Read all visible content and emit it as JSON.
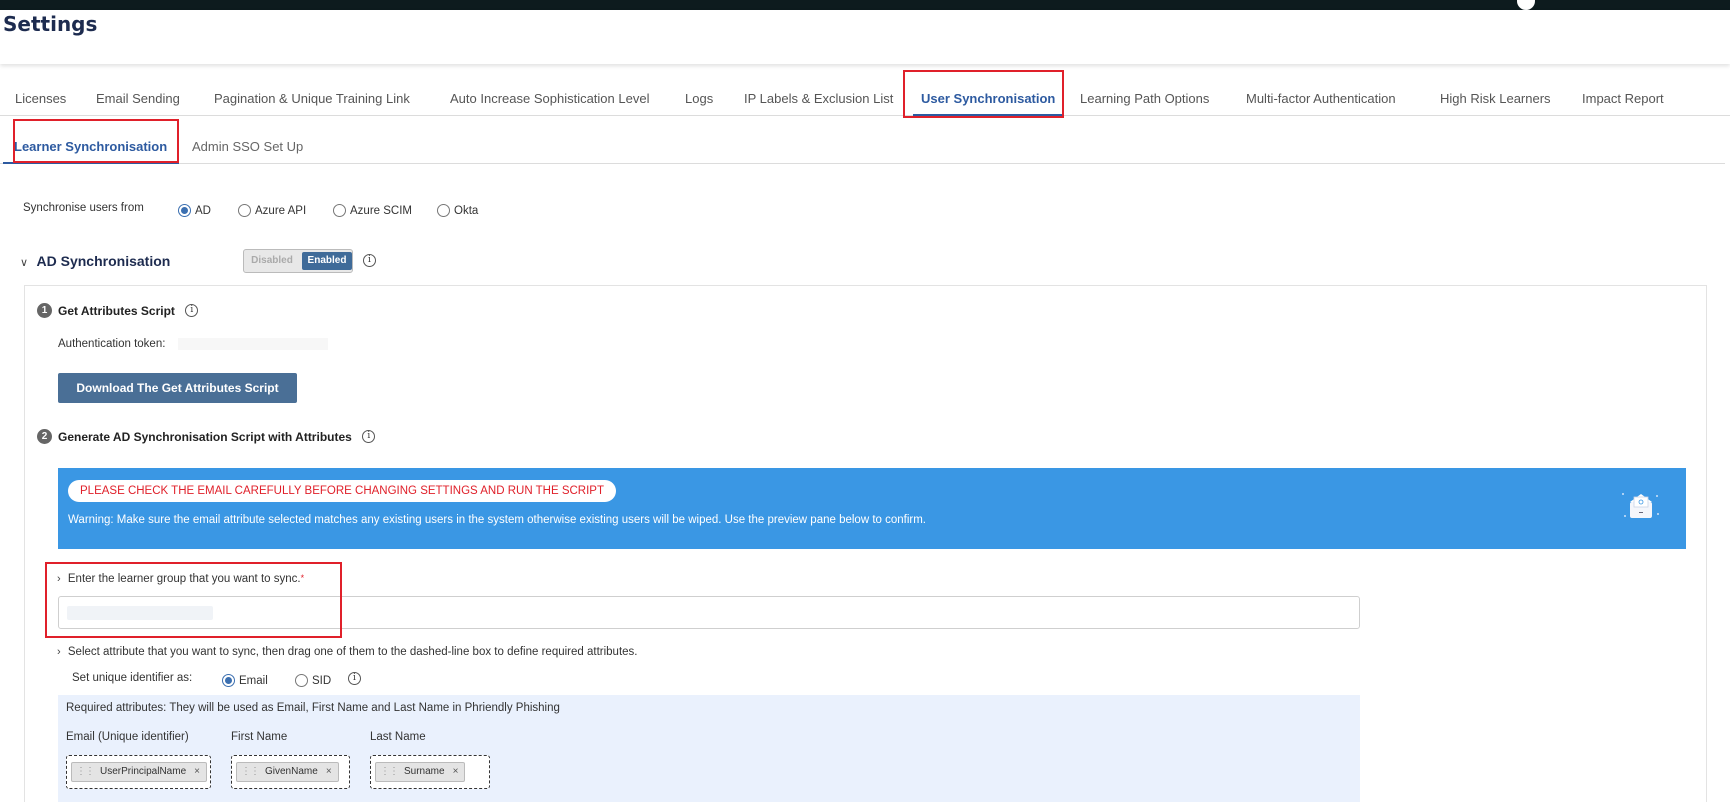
{
  "page": {
    "title": "Settings"
  },
  "tabs": [
    {
      "label": "Licenses"
    },
    {
      "label": "Email Sending"
    },
    {
      "label": "Pagination & Unique Training Link"
    },
    {
      "label": "Auto Increase Sophistication Level"
    },
    {
      "label": "Logs"
    },
    {
      "label": "IP Labels & Exclusion List"
    },
    {
      "label": "User Synchronisation"
    },
    {
      "label": "Learning Path Options"
    },
    {
      "label": "Multi-factor Authentication"
    },
    {
      "label": "High Risk Learners"
    },
    {
      "label": "Impact Report"
    }
  ],
  "active_tab": "User Synchronisation",
  "subtabs": [
    {
      "label": "Learner Synchronisation"
    },
    {
      "label": "Admin SSO Set Up"
    }
  ],
  "active_subtab": "Learner Synchronisation",
  "sync_source": {
    "label": "Synchronise users from",
    "options": [
      {
        "label": "AD",
        "checked": true
      },
      {
        "label": "Azure API",
        "checked": false
      },
      {
        "label": "Azure SCIM",
        "checked": false
      },
      {
        "label": "Okta",
        "checked": false
      }
    ]
  },
  "ad_section": {
    "title": "AD Synchronisation",
    "toggle_off": "Disabled",
    "toggle_on": "Enabled",
    "toggle_state": "Enabled"
  },
  "step1": {
    "number": "1",
    "title": "Get Attributes Script",
    "token_label": "Authentication token:",
    "download_button": "Download The Get Attributes Script"
  },
  "step2": {
    "number": "2",
    "title": "Generate AD Synchronisation Script with Attributes",
    "banner_alert": "PLEASE CHECK THE EMAIL CAREFULLY BEFORE CHANGING SETTINGS AND RUN THE SCRIPT",
    "banner_warning": "Warning: Make sure the email attribute selected matches any existing users in the system otherwise existing users will be wiped. Use the preview pane below to confirm.",
    "group_prompt": "Enter the learner group that you want to sync.",
    "group_required_mark": "*",
    "attr_prompt": "Select attribute that you want to sync, then drag one of them to the dashed-line box to define required attributes.",
    "unique_id": {
      "label": "Set unique identifier as:",
      "options": [
        {
          "label": "Email",
          "checked": true
        },
        {
          "label": "SID",
          "checked": false
        }
      ]
    },
    "required_text": "Required attributes: They will be used as Email, First Name and Last Name in Phriendly Phishing",
    "required_columns": [
      {
        "label": "Email (Unique identifier)",
        "chip": "UserPrincipalName"
      },
      {
        "label": "First Name",
        "chip": "GivenName"
      },
      {
        "label": "Last Name",
        "chip": "Surname"
      }
    ]
  },
  "colors": {
    "accent": "#2d5aa0",
    "button": "#4a6f96",
    "banner": "#3a97e4",
    "alert_text": "#e0202a",
    "highlight_box": "#e0202a"
  }
}
